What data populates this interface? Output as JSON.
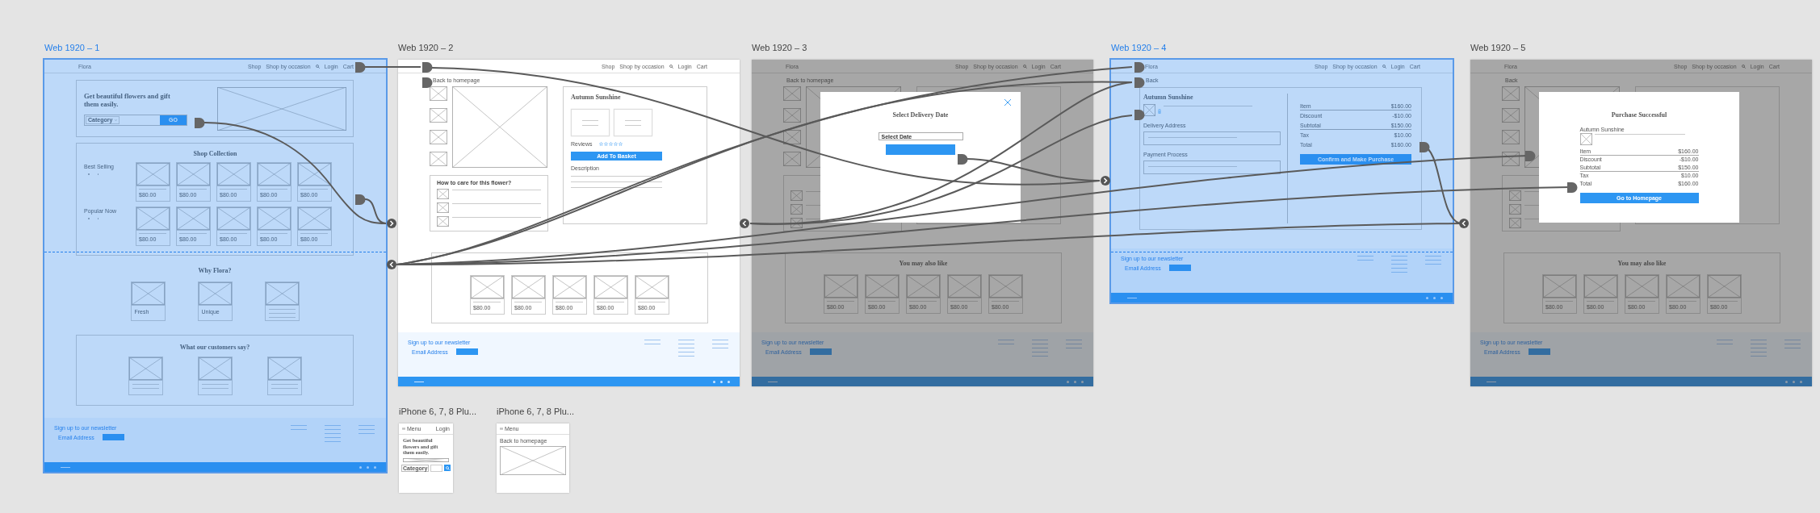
{
  "artboards": [
    {
      "title": "Web 1920 – 1",
      "selected": true,
      "kind": "home",
      "nav": {
        "logo": "Flora",
        "items": [
          {
            "kind": "link",
            "label": "Shop"
          },
          {
            "kind": "link",
            "label": "Shop by occasion"
          },
          {
            "kind": "search"
          },
          {
            "kind": "link",
            "label": "Login"
          },
          {
            "kind": "link",
            "label": "Cart"
          }
        ]
      },
      "hero": {
        "headline": "Get beautiful flowers and gift them easily.",
        "category": "Category",
        "button": "GO"
      },
      "collection": {
        "title": "Shop Collection",
        "rows": [
          {
            "label": "Best Selling",
            "prices": [
              "$80.00",
              "$80.00",
              "$80.00",
              "$80.00",
              "$80.00"
            ]
          },
          {
            "label": "Popular Now",
            "prices": [
              "$80.00",
              "$80.00",
              "$80.00",
              "$80.00",
              "$80.00"
            ]
          }
        ]
      },
      "why": {
        "title": "Why Flora?",
        "cards": [
          {
            "kind": "caption",
            "caption": "Fresh"
          },
          {
            "kind": "caption",
            "caption": "Unique"
          },
          {
            "kind": "lines"
          }
        ]
      },
      "testimonials": {
        "title": "What our customers say?"
      },
      "footer": {
        "newsletter": "Sign up to our newsletter",
        "email_placeholder": "Email Address"
      }
    },
    {
      "title": "Web 1920 – 2",
      "selected": false,
      "kind": "product",
      "nav": {
        "items": [
          {
            "kind": "link",
            "label": "Shop"
          },
          {
            "kind": "link",
            "label": "Shop by occasion"
          },
          {
            "kind": "search"
          },
          {
            "kind": "link",
            "label": "Login"
          },
          {
            "kind": "link",
            "label": "Cart"
          }
        ]
      },
      "back": "Back to homepage",
      "product": {
        "name": "Autumn Sunshine",
        "reviews_label": "Reviews",
        "button": "Add To Basket",
        "description_label": "Description"
      },
      "care": {
        "title": "How to care for this flower?"
      },
      "related": {
        "prices": [
          "$80.00",
          "$80.00",
          "$80.00",
          "$80.00",
          "$80.00"
        ]
      },
      "footer": {
        "newsletter": "Sign up to our newsletter",
        "email_placeholder": "Email Address"
      }
    },
    {
      "title": "Web 1920 – 3",
      "selected": false,
      "kind": "product",
      "nav": {
        "logo": "Flora",
        "items": [
          {
            "kind": "link",
            "label": "Shop"
          },
          {
            "kind": "link",
            "label": "Shop by occasion"
          },
          {
            "kind": "search"
          },
          {
            "kind": "link",
            "label": "Login"
          },
          {
            "kind": "link",
            "label": "Cart"
          }
        ]
      },
      "back": "Back to homepage",
      "related": {
        "title": "You may also like",
        "prices": [
          "$80.00",
          "$80.00",
          "$80.00",
          "$80.00",
          "$80.00"
        ]
      },
      "footer": {
        "newsletter": "Sign up to our newsletter",
        "email_placeholder": "Email Address"
      },
      "modal": {
        "kind": "date",
        "title": "Select Delivery Date",
        "field_placeholder": "Select Date"
      }
    },
    {
      "title": "Web 1920 – 4",
      "selected": true,
      "kind": "checkout",
      "nav": {
        "logo": "Flora",
        "items": [
          {
            "kind": "link",
            "label": "Shop"
          },
          {
            "kind": "link",
            "label": "Shop by occasion"
          },
          {
            "kind": "search"
          },
          {
            "kind": "link",
            "label": "Login"
          },
          {
            "kind": "link",
            "label": "Cart"
          }
        ]
      },
      "back": "Back",
      "checkout": {
        "name": "Autumn Sunshine",
        "delivery_label": "Delivery Address",
        "payment_label": "Payment Process",
        "summary": [
          {
            "label": "Item",
            "value": "$160.00"
          },
          {
            "label": "Discount",
            "value": "-$10.00"
          },
          {
            "label": "Subtotal",
            "value": "$150.00"
          },
          {
            "label": "Tax",
            "value": "$10.00"
          },
          {
            "label": "Total",
            "value": "$160.00"
          }
        ],
        "button": "Confirm and Make Purchase"
      },
      "footer": {
        "newsletter": "Sign up to our newsletter",
        "email_placeholder": "Email Address"
      }
    },
    {
      "title": "Web 1920 – 5",
      "selected": false,
      "kind": "product",
      "nav": {
        "logo": "Flora",
        "items": [
          {
            "kind": "link",
            "label": "Shop"
          },
          {
            "kind": "link",
            "label": "Shop by occasion"
          },
          {
            "kind": "search"
          },
          {
            "kind": "link",
            "label": "Login"
          },
          {
            "kind": "link",
            "label": "Cart"
          }
        ]
      },
      "back": "Back",
      "related": {
        "title": "You may also like",
        "prices": [
          "$80.00",
          "$80.00",
          "$80.00",
          "$80.00",
          "$80.00"
        ]
      },
      "footer": {
        "newsletter": "Sign up to our newsletter",
        "email_placeholder": "Email Address"
      },
      "modal": {
        "kind": "receipt",
        "title": "Purchase Successful",
        "item": "Autumn Sunshine",
        "summary": [
          {
            "label": "Item",
            "value": "$160.00"
          },
          {
            "label": "Discount",
            "value": "-$10.00"
          },
          {
            "label": "Subtotal",
            "value": "$150.00"
          },
          {
            "label": "Tax",
            "value": "$10.00"
          },
          {
            "label": "Total",
            "value": "$160.00"
          }
        ],
        "button": "Go to Homepage"
      }
    },
    {
      "title": "iPhone 6, 7, 8 Plu...",
      "selected": false,
      "kind": "phone_home",
      "menu": "Menu",
      "login": "Login",
      "headline": "Get beautiful flowers and gift them easily.",
      "category": "Category"
    },
    {
      "title": "iPhone 6, 7, 8 Plu...",
      "selected": false,
      "kind": "phone_product",
      "menu": "Menu",
      "back": "Back to homepage"
    }
  ]
}
